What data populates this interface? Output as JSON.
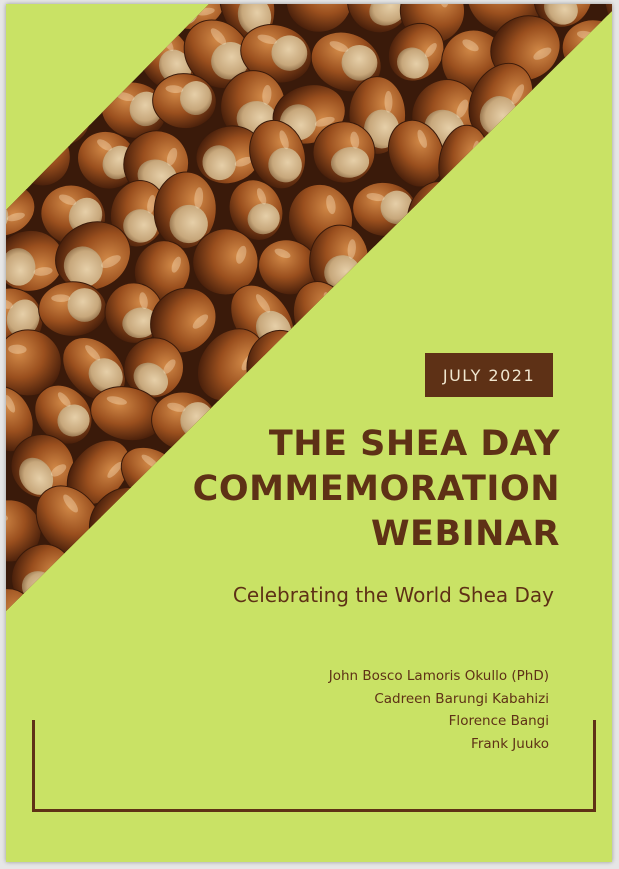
{
  "cover": {
    "date": "JULY 2021",
    "title_lines": [
      "THE SHEA DAY",
      "COMMEMORATION",
      "WEBINAR"
    ],
    "subtitle": "Celebrating the World Shea Day",
    "authors": [
      "John Bosco Lamoris Okullo (PhD)",
      "Cadreen Barungi Kabahizi",
      "Florence Bangi",
      "Frank Juuko"
    ]
  },
  "colors": {
    "background": "#c9e265",
    "accent": "#5e3116",
    "badge_text": "#f0e6cf"
  },
  "image": {
    "subject": "pile of shea nuts photograph"
  }
}
